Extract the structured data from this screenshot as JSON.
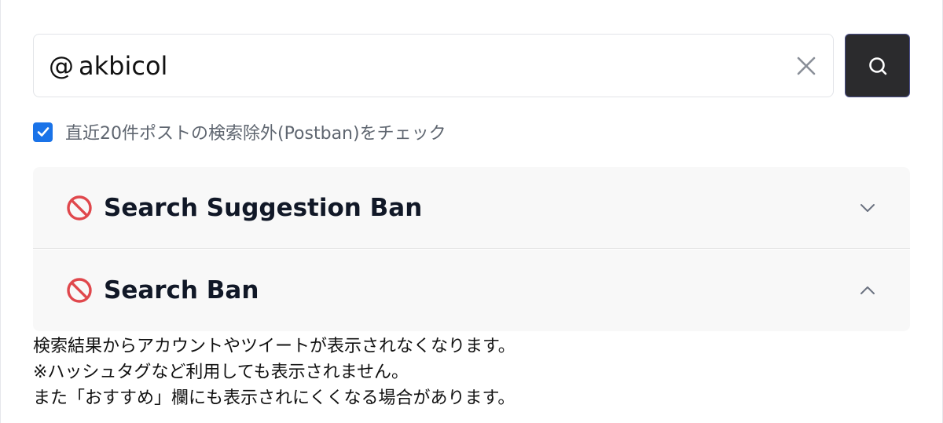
{
  "search": {
    "prefix": "@",
    "value": "akbicol",
    "clear_icon": "close-icon",
    "submit_icon": "search-icon"
  },
  "postban_check": {
    "checked": true,
    "label": "直近20件ポストの検索除外(Postban)をチェック"
  },
  "results": [
    {
      "title": "Search Suggestion Ban",
      "status_icon": "prohibited-icon",
      "expanded": false,
      "chevron_icon": "chevron-down-icon"
    },
    {
      "title": "Search Ban",
      "status_icon": "prohibited-icon",
      "expanded": true,
      "chevron_icon": "chevron-up-icon",
      "description": [
        "検索結果からアカウントやツイートが表示されなくなります。",
        "※ハッシュタグなど利用しても表示されません。",
        "また「おすすめ」欄にも表示されにくくなる場合があります。"
      ]
    }
  ],
  "colors": {
    "accent": "#1a73e8",
    "ban": "#e0474c",
    "search_button": "#2b2b2d",
    "panel_bg": "#f8f8f8"
  }
}
